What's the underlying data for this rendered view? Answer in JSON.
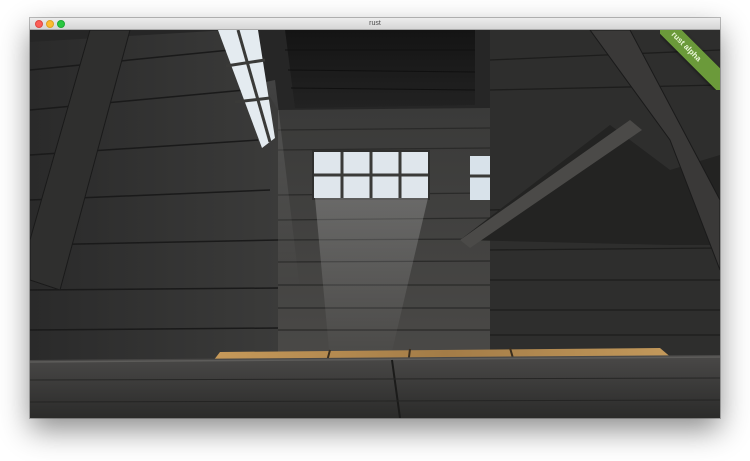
{
  "window": {
    "title": "rust"
  },
  "game": {
    "badge": "rust alpha",
    "badge_color": "#6b9a3a",
    "scene": "wooden-house-interior"
  }
}
